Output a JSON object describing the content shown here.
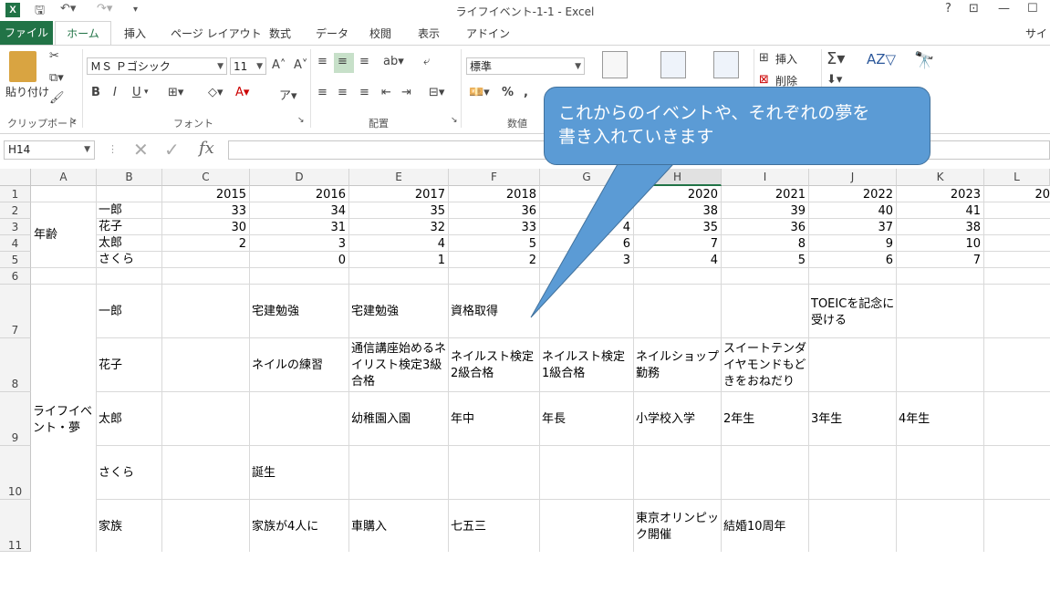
{
  "window": {
    "title": "ライフイベント-1-1 - Excel",
    "help": "?",
    "signin": "サイン"
  },
  "tabs": [
    "ファイル",
    "ホーム",
    "挿入",
    "ページ レイアウト",
    "数式",
    "データ",
    "校閲",
    "表示",
    "アドイン"
  ],
  "ribbon": {
    "paste": "貼り付け",
    "font_name": "ＭＳ Ｐゴシック",
    "font_size": "11",
    "bold": "B",
    "italic": "I",
    "underline": "U",
    "number_format": "標準",
    "percent": "%",
    "comma": ",",
    "insert": "挿入",
    "delete": "削除",
    "group_clipboard": "クリップボード",
    "group_font": "フォント",
    "group_alignment": "配置",
    "group_number": "数値"
  },
  "formula_bar": {
    "name_box": "H14",
    "fx": "fx",
    "value": ""
  },
  "columns": [
    "A",
    "B",
    "C",
    "D",
    "E",
    "F",
    "G",
    "H",
    "I",
    "J",
    "K",
    "L"
  ],
  "rows": [
    "1",
    "2",
    "3",
    "4",
    "5",
    "6",
    "7",
    "8",
    "9",
    "10",
    "11"
  ],
  "cells": {
    "r1": [
      "2015",
      "2016",
      "2017",
      "2018",
      "",
      "2020",
      "2021",
      "2022",
      "2023",
      "20"
    ],
    "age_label": "年齢",
    "names": [
      "一郎",
      "花子",
      "太郎",
      "さくら"
    ],
    "r2": [
      "33",
      "34",
      "35",
      "36",
      "",
      "38",
      "39",
      "40",
      "41"
    ],
    "r3": [
      "30",
      "31",
      "32",
      "33",
      "4",
      "35",
      "36",
      "37",
      "38"
    ],
    "r4": [
      "2",
      "3",
      "4",
      "5",
      "6",
      "7",
      "8",
      "9",
      "10"
    ],
    "r5": [
      "",
      "0",
      "1",
      "2",
      "3",
      "4",
      "5",
      "6",
      "7"
    ],
    "life_label": "ライフイベント・夢",
    "r7": {
      "name": "一郎",
      "D": "宅建勉強",
      "E": "宅建勉強",
      "F": "資格取得",
      "J": "TOEICを記念に受ける"
    },
    "r8": {
      "name": "花子",
      "D": "ネイルの練習",
      "E": "通信講座始めるネイリスト検定3級合格",
      "F": "ネイルスト検定2級合格",
      "G": "ネイルスト検定1級合格",
      "H": "ネイルショップ勤務",
      "I": "スイートテンダイヤモンドもどきをおねだり"
    },
    "r9": {
      "name": "太郎",
      "E": "幼稚園入園",
      "F": "年中",
      "G": "年長",
      "H": "小学校入学",
      "I": "2年生",
      "J": "3年生",
      "K": "4年生"
    },
    "r10": {
      "name": "さくら",
      "D": "誕生"
    },
    "r11": {
      "name": "家族",
      "D": "家族が4人に",
      "E": "車購入",
      "F": "七五三",
      "H": "東京オリンピック開催",
      "I": "結婚10周年"
    }
  },
  "callout": {
    "line1": "これからのイベントや、それぞれの夢を",
    "line2": "書き入れていきます",
    "color": "#5b9bd5"
  }
}
